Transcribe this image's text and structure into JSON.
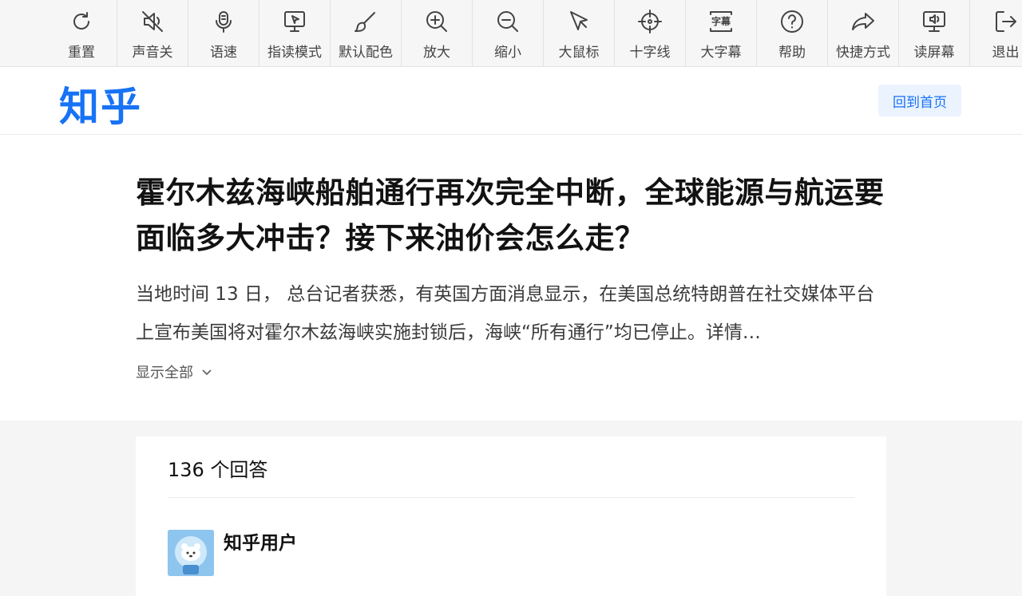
{
  "toolbar": {
    "items": [
      {
        "label": "重置",
        "icon": "refresh-icon"
      },
      {
        "label": "声音关",
        "icon": "speaker-mute-icon"
      },
      {
        "label": "语速",
        "icon": "microphone-icon"
      },
      {
        "label": "指读模式",
        "icon": "pointer-read-icon"
      },
      {
        "label": "默认配色",
        "icon": "brush-icon"
      },
      {
        "label": "放大",
        "icon": "zoom-in-icon"
      },
      {
        "label": "缩小",
        "icon": "zoom-out-icon"
      },
      {
        "label": "大鼠标",
        "icon": "cursor-icon"
      },
      {
        "label": "十字线",
        "icon": "crosshair-icon"
      },
      {
        "label": "大字幕",
        "icon": "caption-icon"
      },
      {
        "label": "帮助",
        "icon": "help-icon"
      },
      {
        "label": "快捷方式",
        "icon": "share-arrow-icon"
      },
      {
        "label": "读屏幕",
        "icon": "screen-reader-icon"
      },
      {
        "label": "退出",
        "icon": "exit-icon"
      }
    ],
    "caption_icon_text": "字幕"
  },
  "header": {
    "logo": "知乎",
    "home_button": "回到首页"
  },
  "question": {
    "title": "霍尔木兹海峡船舶通行再次完全中断，全球能源与航运要面临多大冲击？接下来油价会怎么走？",
    "excerpt": "当地时间 13 日， 总台记者获悉，有英国方面消息显示，在美国总统特朗普在社交媒体平台上宣布美国将对霍尔木兹海峡实施封锁后，海峡“所有通行”均已停止。详情…",
    "show_all": "显示全部"
  },
  "answers": {
    "count_label": "136 个回答",
    "first_author": "知乎用户"
  },
  "colors": {
    "brand": "#1772f6",
    "home_button_bg": "#ebf3ff",
    "toolbar_bg": "#f6f6f6",
    "page_bg": "#f5f5f6"
  }
}
